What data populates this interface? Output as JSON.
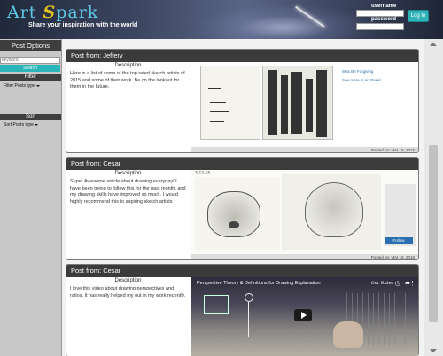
{
  "header": {
    "logo_art": "Art ",
    "logo_s": "S",
    "logo_rest": "park",
    "tagline": "Share your inspiration with the world",
    "username_label": "username",
    "password_label": "password",
    "login_button": "Log In"
  },
  "sidebar": {
    "post_options_title": "Post Options",
    "search_placeholder": "keyword",
    "search_button": "Search",
    "filter_title": "Filter",
    "filter_dropdown": "Filter Posts type",
    "sort_title": "Sort",
    "sort_dropdown": "Sort Posts type"
  },
  "posts": [
    {
      "title": "Post from: Jeffery",
      "description_label": "Description",
      "description": "Here is a list of some of the top rated sketch artists of 2015 and some of their work. Be on the lookout for them in the future.",
      "posted": "Posted on: Mar 16, 2016",
      "media_links": [
        "Was Be Forgiving",
        "See more in Art Basel"
      ]
    },
    {
      "title": "Post from: Cesar",
      "description_label": "Description",
      "description": "Super Awesome article about drawing everyday! I have been trying to follow this for the past month, and my drawing skills have improved so much. I would highly recommend this to aspiring sketch artists",
      "posted": "Posted on: Mar 16, 2016",
      "media_caption": "3-12-15",
      "follow_button": "Follow"
    },
    {
      "title": "Post from: Cesar",
      "description_label": "Description",
      "description": "I love this video about drawing perspectives and ratios. It has really helped my out in my work recently.",
      "video_title": "Perspective Theory & Definitions for Drawing Explanation",
      "video_corner": "Our Rules"
    }
  ],
  "colors": {
    "accent": "#2cb5b8",
    "header_dark": "#3b3b3b",
    "logo_blue": "#5ec7e6",
    "logo_yellow": "#e3c21a"
  }
}
